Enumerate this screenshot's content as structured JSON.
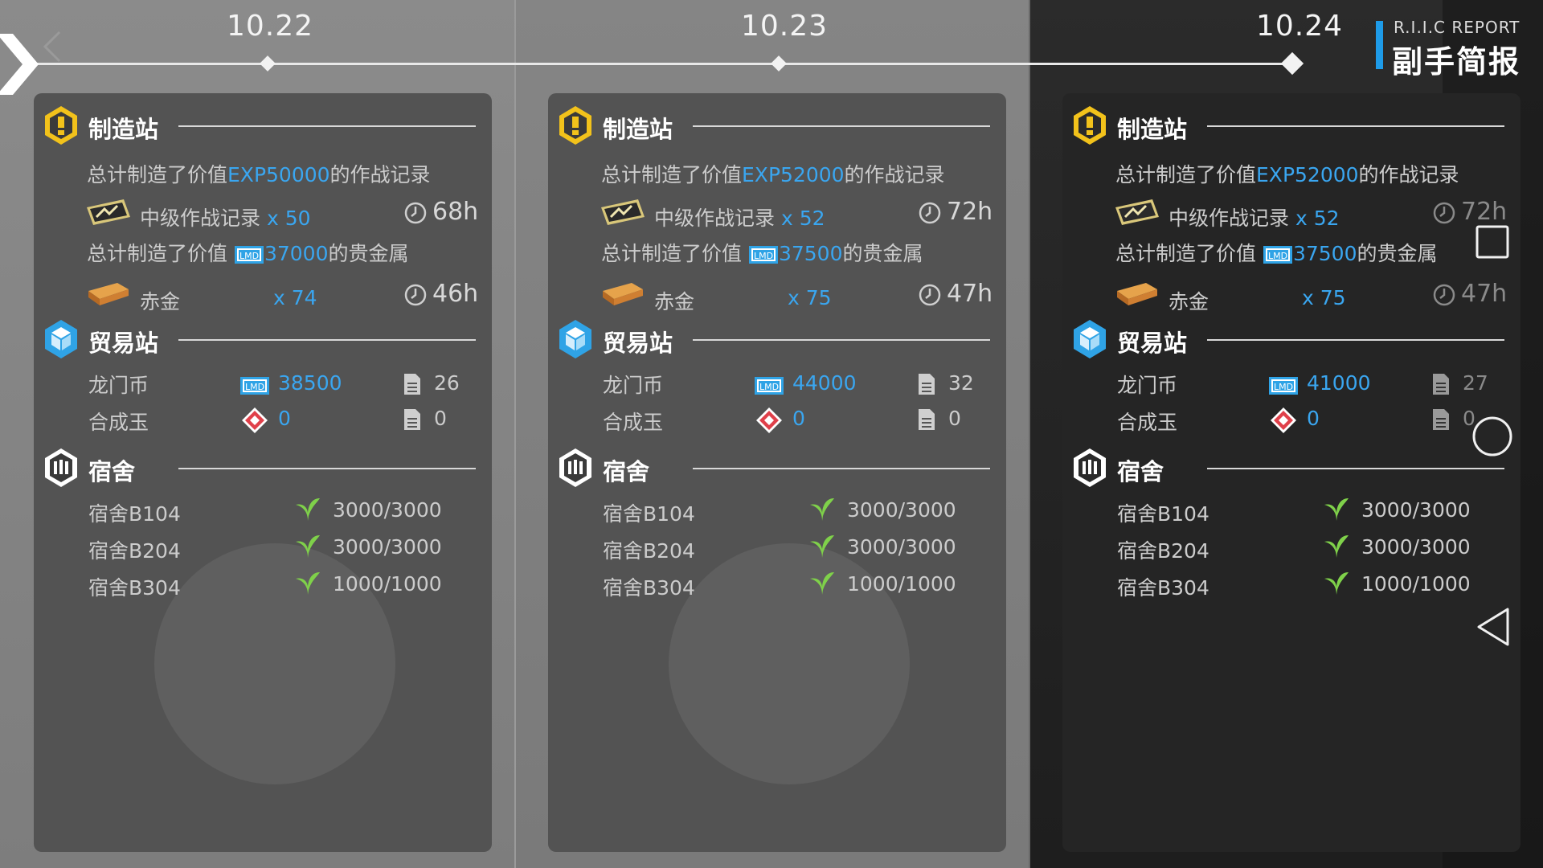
{
  "report": {
    "title_en": "R.I.I.C REPORT",
    "title_cn": "副手简报"
  },
  "columns": [
    {
      "date": "10.22",
      "factory": {
        "title": "制造站",
        "exp_prefix": "总计制造了价值",
        "exp_value": "EXP50000",
        "exp_suffix": "的作战记录",
        "record_name": "中级作战记录",
        "record_count": "x 50",
        "record_time": "68h",
        "gold_prefix": "总计制造了价值",
        "gold_value": "37000",
        "gold_suffix": "的贵金属",
        "gold_name": "赤金",
        "gold_count": "x 74",
        "gold_time": "46h"
      },
      "trade": {
        "title": "贸易站",
        "lmd_label": "龙门币",
        "lmd_value": "38500",
        "lmd_orders": "26",
        "orundum_label": "合成玉",
        "orundum_value": "0",
        "orundum_orders": "0"
      },
      "dorm": {
        "title": "宿舍",
        "rooms": [
          {
            "name": "宿舍B104",
            "value": "3000/3000"
          },
          {
            "name": "宿舍B204",
            "value": "3000/3000"
          },
          {
            "name": "宿舍B304",
            "value": "1000/1000"
          }
        ]
      }
    },
    {
      "date": "10.23",
      "factory": {
        "title": "制造站",
        "exp_prefix": "总计制造了价值",
        "exp_value": "EXP52000",
        "exp_suffix": "的作战记录",
        "record_name": "中级作战记录",
        "record_count": "x 52",
        "record_time": "72h",
        "gold_prefix": "总计制造了价值",
        "gold_value": "37500",
        "gold_suffix": "的贵金属",
        "gold_name": "赤金",
        "gold_count": "x 75",
        "gold_time": "47h"
      },
      "trade": {
        "title": "贸易站",
        "lmd_label": "龙门币",
        "lmd_value": "44000",
        "lmd_orders": "32",
        "orundum_label": "合成玉",
        "orundum_value": "0",
        "orundum_orders": "0"
      },
      "dorm": {
        "title": "宿舍",
        "rooms": [
          {
            "name": "宿舍B104",
            "value": "3000/3000"
          },
          {
            "name": "宿舍B204",
            "value": "3000/3000"
          },
          {
            "name": "宿舍B304",
            "value": "1000/1000"
          }
        ]
      }
    },
    {
      "date": "10.24",
      "factory": {
        "title": "制造站",
        "exp_prefix": "总计制造了价值",
        "exp_value": "EXP52000",
        "exp_suffix": "的作战记录",
        "record_name": "中级作战记录",
        "record_count": "x 52",
        "record_time": "72h",
        "gold_prefix": "总计制造了价值",
        "gold_value": "37500",
        "gold_suffix": "的贵金属",
        "gold_name": "赤金",
        "gold_count": "x 75",
        "gold_time": "47h"
      },
      "trade": {
        "title": "贸易站",
        "lmd_label": "龙门币",
        "lmd_value": "41000",
        "lmd_orders": "27",
        "orundum_label": "合成玉",
        "orundum_value": "0",
        "orundum_orders": "0"
      },
      "dorm": {
        "title": "宿舍",
        "rooms": [
          {
            "name": "宿舍B104",
            "value": "3000/3000"
          },
          {
            "name": "宿舍B204",
            "value": "3000/3000"
          },
          {
            "name": "宿舍B304",
            "value": "1000/1000"
          }
        ]
      }
    }
  ],
  "colors": {
    "accent_blue": "#3aa6f0",
    "factory_yellow": "#f2c21b",
    "trade_blue": "#2fa3e6",
    "leaf_green": "#7fd14a"
  },
  "icons": [
    "back-chevron-icon",
    "factory-icon",
    "battle-record-icon",
    "clock-icon",
    "lmd-icon",
    "gold-bar-icon",
    "trade-cube-icon",
    "originium-icon",
    "document-icon",
    "dorm-icon",
    "leaf-icon",
    "square-icon",
    "circle-icon",
    "triangle-back-icon"
  ],
  "selected_date": "10.24"
}
